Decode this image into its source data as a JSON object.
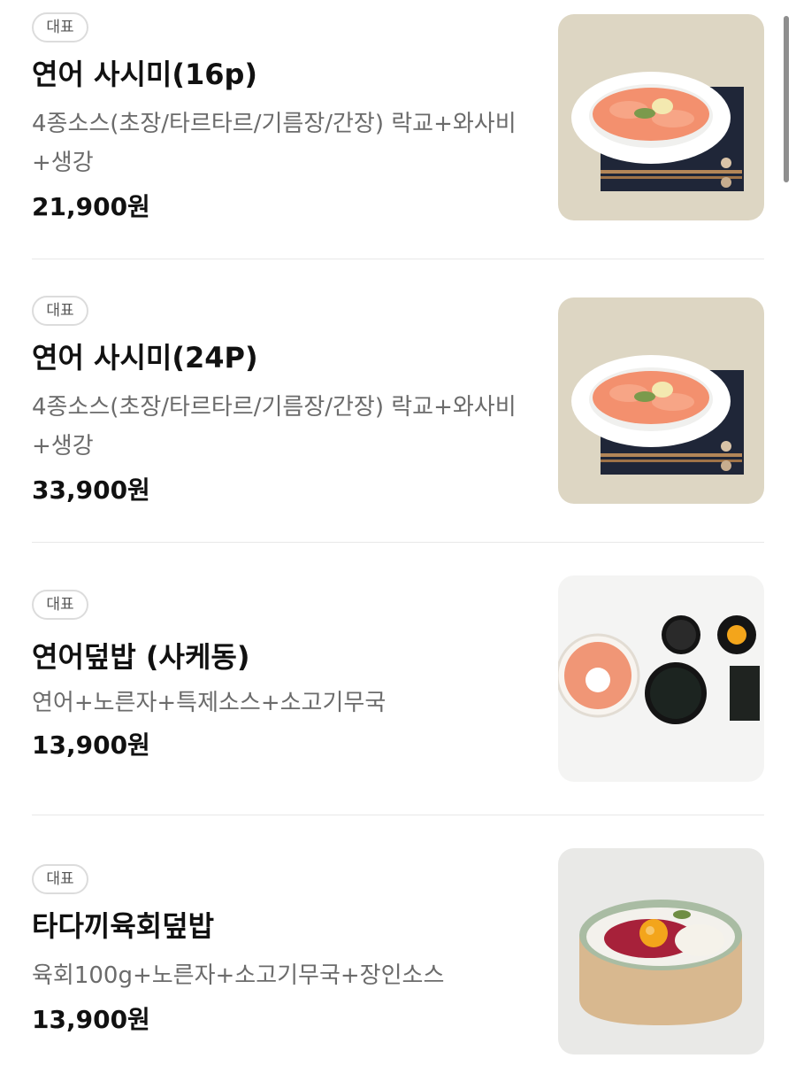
{
  "menu": {
    "items": [
      {
        "badge": "대표",
        "name": "연어 사시미(16p)",
        "description": "4종소스(초장/타르타르/기름장/간장) 락교+와사비+생강",
        "price": "21,900원",
        "image": "salmon-sashimi-plate-image"
      },
      {
        "badge": "대표",
        "name": "연어 사시미(24P)",
        "description": "4종소스(초장/타르타르/기름장/간장) 락교+와사비+생강",
        "price": "33,900원",
        "image": "salmon-sashimi-plate-image"
      },
      {
        "badge": "대표",
        "name": "연어덮밥 (사케동)",
        "description": "연어+노른자+특제소스+소고기무국",
        "price": "13,900원",
        "image": "salmon-rice-bowl-set-image"
      },
      {
        "badge": "대표",
        "name": "타다끼육회덮밥",
        "description": "육회100g+노른자+소고기무국+장인소스",
        "price": "13,900원",
        "image": "beef-tartare-rice-bowl-image"
      }
    ]
  },
  "colors": {
    "text_primary": "#111111",
    "text_secondary": "#6b6b6b",
    "badge_border": "#dcdcdc",
    "divider": "#e8e8e8"
  }
}
